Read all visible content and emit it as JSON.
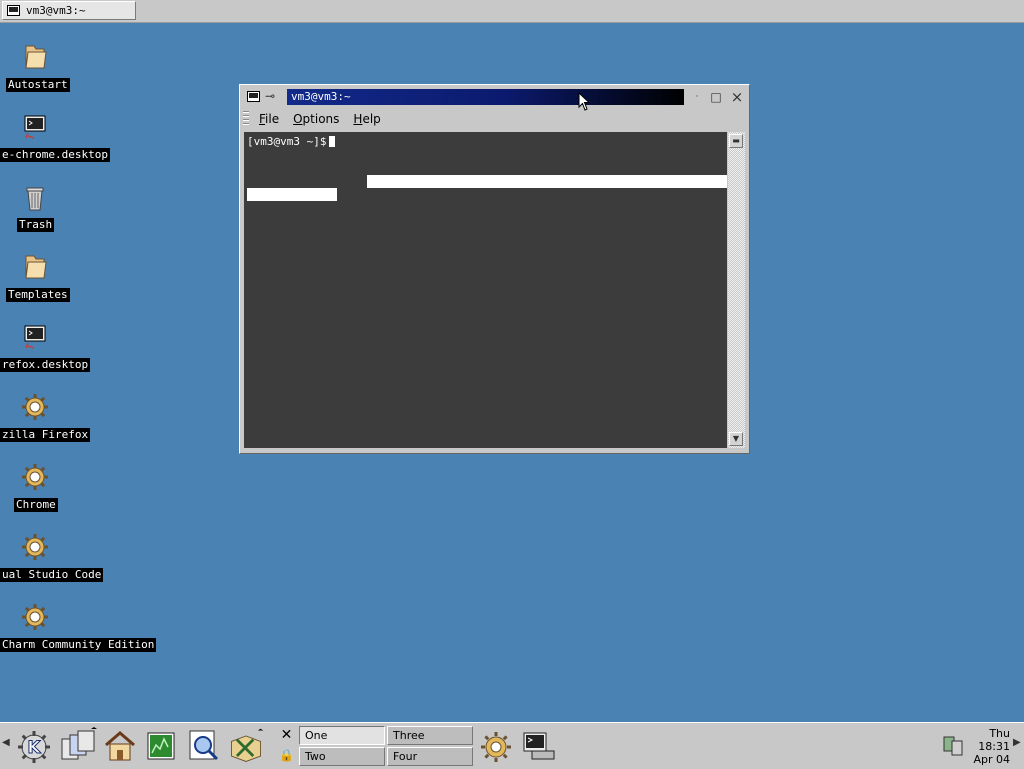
{
  "top_taskbar": {
    "task_label": "vm3@vm3:~"
  },
  "desktop": {
    "icons": [
      {
        "label": "Autostart",
        "icon": "folder-icon"
      },
      {
        "label": "e-chrome.desktop",
        "icon": "terminal-icon"
      },
      {
        "label": "Trash",
        "icon": "trash-icon"
      },
      {
        "label": "Templates",
        "icon": "folder-icon"
      },
      {
        "label": "refox.desktop",
        "icon": "terminal-icon"
      },
      {
        "label": "zilla Firefox",
        "icon": "gear-icon"
      },
      {
        "label": "Chrome",
        "icon": "gear-icon"
      },
      {
        "label": "ual Studio Code",
        "icon": "gear-icon"
      },
      {
        "label": "Charm Community Edition",
        "icon": "gear-icon"
      }
    ]
  },
  "window": {
    "title": "vm3@vm3:~",
    "menu": {
      "file": "File",
      "options": "Options",
      "help": "Help"
    },
    "terminal": {
      "prompt": "[vm3@vm3 ~]$"
    }
  },
  "panel": {
    "workspaces": [
      "One",
      "Three",
      "Two",
      "Four"
    ],
    "clock": {
      "day": "Thu",
      "time": "18:31",
      "date": "Apr 04"
    }
  },
  "colors": {
    "desktop_bg": "#4a82b4",
    "title_active": "#0b1a6e",
    "terminal_bg": "#3c3c3c"
  }
}
